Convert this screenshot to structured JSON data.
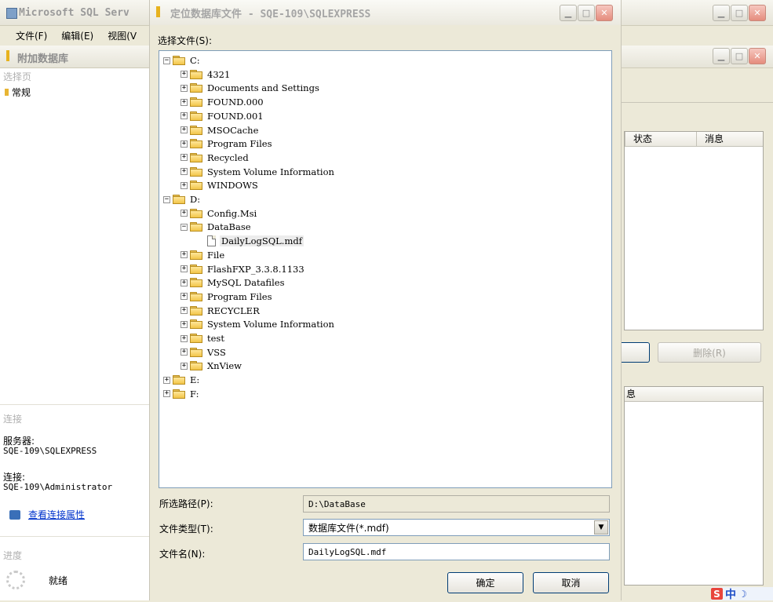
{
  "app": {
    "title": "Microsoft SQL Serv",
    "menu": [
      "文件(F)",
      "编辑(E)",
      "视图(V"
    ]
  },
  "attach_window": {
    "title": "附加数据库",
    "select_page": "选择页",
    "page_general": "常规",
    "connection_heading": "连接",
    "server_label": "服务器:",
    "server_value": "SQE-109\\SQLEXPRESS",
    "conn_label": "连接:",
    "conn_value": "SQE-109\\Administrator",
    "view_props_link": "查看连接属性",
    "progress_heading": "进度",
    "progress_status": "就绪",
    "grid_cols": [
      "状态",
      "消息"
    ],
    "remove_button": "删除(R)",
    "lower_grid_col": "息"
  },
  "dialog": {
    "title": "定位数据库文件 - SQE-109\\SQLEXPRESS",
    "select_file_label": "选择文件(S):",
    "tree": [
      {
        "label": "C:",
        "level": 0,
        "exp": "minus",
        "type": "folder"
      },
      {
        "label": "4321",
        "level": 1,
        "exp": "plus",
        "type": "folder"
      },
      {
        "label": "Documents and Settings",
        "level": 1,
        "exp": "plus",
        "type": "folder"
      },
      {
        "label": "FOUND.000",
        "level": 1,
        "exp": "plus",
        "type": "folder"
      },
      {
        "label": "FOUND.001",
        "level": 1,
        "exp": "plus",
        "type": "folder"
      },
      {
        "label": "MSOCache",
        "level": 1,
        "exp": "plus",
        "type": "folder"
      },
      {
        "label": "Program Files",
        "level": 1,
        "exp": "plus",
        "type": "folder"
      },
      {
        "label": "Recycled",
        "level": 1,
        "exp": "plus",
        "type": "folder"
      },
      {
        "label": "System Volume Information",
        "level": 1,
        "exp": "plus",
        "type": "folder"
      },
      {
        "label": "WINDOWS",
        "level": 1,
        "exp": "plus",
        "type": "folder"
      },
      {
        "label": "D:",
        "level": 0,
        "exp": "minus",
        "type": "folder"
      },
      {
        "label": "Config.Msi",
        "level": 1,
        "exp": "plus",
        "type": "folder"
      },
      {
        "label": "DataBase",
        "level": 1,
        "exp": "minus",
        "type": "folder"
      },
      {
        "label": "DailyLogSQL.mdf",
        "level": 2,
        "exp": "none",
        "type": "file",
        "selected": true
      },
      {
        "label": "File",
        "level": 1,
        "exp": "plus",
        "type": "folder"
      },
      {
        "label": "FlashFXP_3.3.8.1133",
        "level": 1,
        "exp": "plus",
        "type": "folder"
      },
      {
        "label": "MySQL Datafiles",
        "level": 1,
        "exp": "plus",
        "type": "folder"
      },
      {
        "label": "Program Files",
        "level": 1,
        "exp": "plus",
        "type": "folder"
      },
      {
        "label": "RECYCLER",
        "level": 1,
        "exp": "plus",
        "type": "folder"
      },
      {
        "label": "System Volume Information",
        "level": 1,
        "exp": "plus",
        "type": "folder"
      },
      {
        "label": "test",
        "level": 1,
        "exp": "plus",
        "type": "folder"
      },
      {
        "label": "VSS",
        "level": 1,
        "exp": "plus",
        "type": "folder"
      },
      {
        "label": "XnView",
        "level": 1,
        "exp": "plus",
        "type": "folder"
      },
      {
        "label": "E:",
        "level": 0,
        "exp": "plus",
        "type": "folder"
      },
      {
        "label": "F:",
        "level": 0,
        "exp": "plus",
        "type": "folder"
      }
    ],
    "path_label": "所选路径(P):",
    "path_value": "D:\\DataBase",
    "filetype_label": "文件类型(T):",
    "filetype_value": "数据库文件(*.mdf)",
    "filename_label": "文件名(N):",
    "filename_value": "DailyLogSQL.mdf",
    "ok_button": "确定",
    "cancel_button": "取消"
  },
  "tray": {
    "ime_logo": "S",
    "ime_mode": "中"
  }
}
